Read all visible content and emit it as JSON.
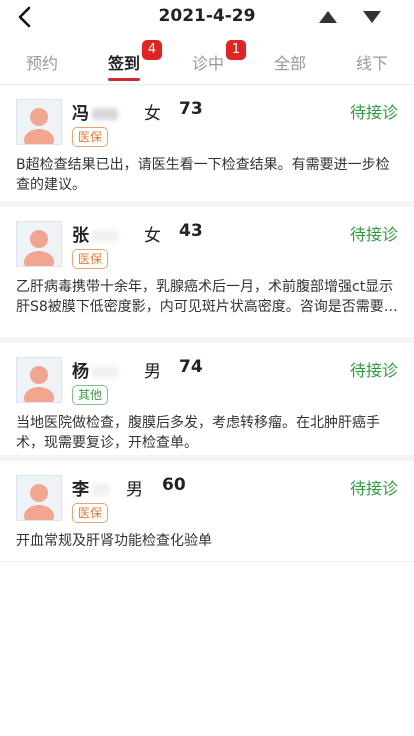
{
  "header": {
    "date": "2021-4-29"
  },
  "tabs": [
    {
      "label": "预约",
      "badge": ""
    },
    {
      "label": "签到",
      "badge": "4"
    },
    {
      "label": "诊中",
      "badge": "1"
    },
    {
      "label": "全部",
      "badge": ""
    },
    {
      "label": "线下",
      "badge": ""
    }
  ],
  "colors": {
    "accent": "#d42727",
    "status_green": "#2e9c3c",
    "tag_orange": "#e37c35",
    "tag_green": "#3b9c48"
  },
  "patients": [
    {
      "surname": "冯",
      "gender": "女",
      "age": "73",
      "tag": "医保",
      "status": "待接诊",
      "description": "B超检查结果已出，请医生看一下检查结果。有需要进一步检查的建议。"
    },
    {
      "surname": "张",
      "gender": "女",
      "age": "43",
      "tag": "医保",
      "status": "待接诊",
      "description": "乙肝病毒携带十余年，乳腺癌术后一月，术前腹部增强ct显示肝S8被膜下低密度影，内可见斑片状高密度。咨询是否需要进一步检查"
    },
    {
      "surname": "杨",
      "gender": "男",
      "age": "74",
      "tag": "其他",
      "status": "待接诊",
      "description": "当地医院做检查，腹膜后多发，考虑转移瘤。在北肿肝癌手术，现需要复诊，开检查单。"
    },
    {
      "surname": "李",
      "gender": "男",
      "age": "60",
      "tag": "医保",
      "status": "待接诊",
      "description": "开血常规及肝肾功能检查化验单"
    }
  ]
}
